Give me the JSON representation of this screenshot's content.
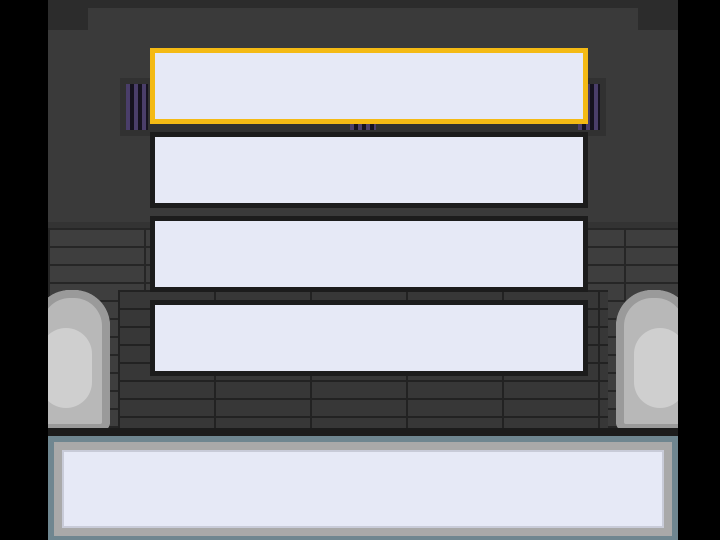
{
  "menu": {
    "selected_index": 0,
    "options": [
      {
        "label": ""
      },
      {
        "label": ""
      },
      {
        "label": ""
      },
      {
        "label": ""
      }
    ]
  },
  "dialog": {
    "text": ""
  },
  "colors": {
    "option_fill": "#e6e9f6",
    "option_border": "#1c1c1c",
    "selected_border": "#f4ba14",
    "dialog_frame": "#6f8690"
  }
}
